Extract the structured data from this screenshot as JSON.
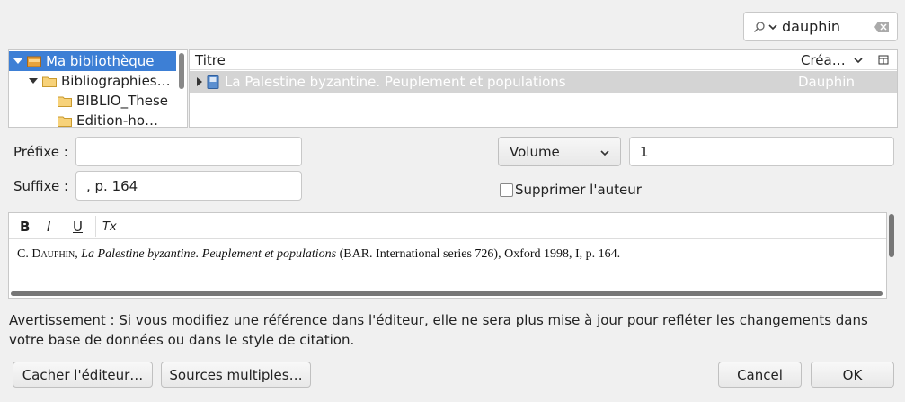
{
  "search": {
    "value": "dauphin"
  },
  "library": {
    "items": [
      {
        "label": "Ma bibliothèque"
      },
      {
        "label": "Bibliographies…"
      },
      {
        "label": "BIBLIO_These"
      },
      {
        "label": "Edition-ho…"
      }
    ]
  },
  "items_list": {
    "columns": {
      "title": "Titre",
      "creator": "Créa…"
    },
    "rows": [
      {
        "title": "La Palestine byzantine. Peuplement et populations",
        "creator": "Dauphin"
      }
    ]
  },
  "form": {
    "prefix_label": "Préfixe :",
    "prefix_value": "",
    "suffix_label": "Suffixe :",
    "suffix_value": ", p. 164",
    "locator_type": "Volume",
    "locator_value": "1",
    "suppress_author_label": "Supprimer l'auteur"
  },
  "editor": {
    "toolbar": {
      "bold": "B",
      "italic": "I",
      "underline": "U",
      "clear": "Tx"
    },
    "citation": {
      "initial": "C. ",
      "author": "Dauphin",
      "sep": ", ",
      "title": "La Palestine byzantine. Peuplement et populations",
      "rest": " (BAR. International series 726), Oxford 1998, I, p. 164."
    }
  },
  "warning": "Avertissement : Si vous modifiez une référence dans l'éditeur, elle ne sera plus mise à jour pour refléter les changements dans votre base de données ou dans le style de citation.",
  "buttons": {
    "hide_editor": "Cacher l'éditeur…",
    "multiple_sources": "Sources multiples…",
    "cancel": "Cancel",
    "ok": "OK"
  }
}
